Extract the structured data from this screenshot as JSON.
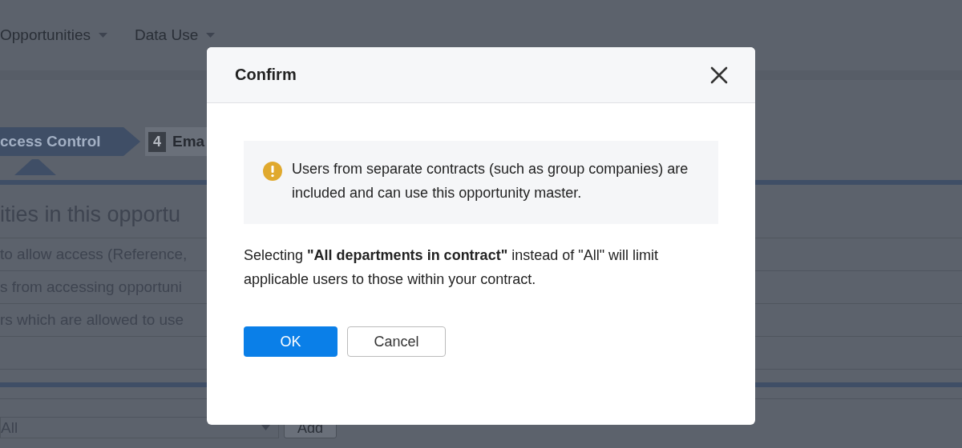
{
  "nav": [
    {
      "label": "Opportunities"
    },
    {
      "label": "Data Use"
    }
  ],
  "steps": [
    {
      "label": "ccess Control",
      "selected": true
    },
    {
      "number": "4",
      "label": "Ema",
      "selected": false
    }
  ],
  "section": {
    "heading": "ities in this opportu",
    "rows": [
      " to allow access (Reference,",
      "s from accessing opportuni",
      "rs which are allowed to use"
    ]
  },
  "department_select": {
    "value": "All"
  },
  "add_button": "Add",
  "dialog": {
    "title": "Confirm",
    "alert": "Users from separate contracts (such as group companies) are included and can use this opportunity master.",
    "message": "Selecting **\"All departments in contract\"** instead of \"All\" will limit applicable users to those within your contract.",
    "buttons": [
      {
        "label": "OK",
        "kind": "primary"
      },
      {
        "label": "Cancel",
        "kind": "secondary"
      }
    ]
  }
}
